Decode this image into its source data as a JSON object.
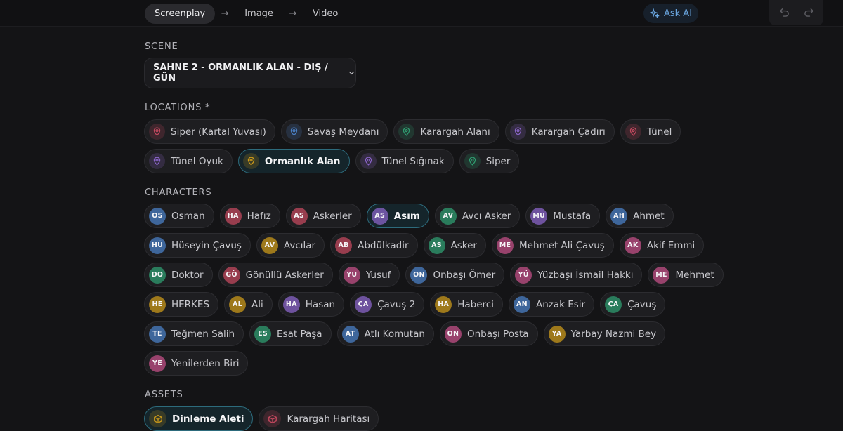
{
  "steps": [
    "Screenplay",
    "Image",
    "Video"
  ],
  "ask_ai": "Ask AI",
  "labels": {
    "scene": "SCENE",
    "locations": "LOCATIONS *",
    "characters": "CHARACTERS",
    "assets": "ASSETS"
  },
  "scene_value": "SAHNE 2 - ORMANLIK ALAN - DIŞ / GÜN",
  "colors": {
    "red": "#c2485e",
    "blue": "#4a7fc4",
    "green": "#2f9c70",
    "purple": "#8a64c8",
    "yellow": "#c9981a",
    "pink": "#c24f86",
    "selected_border": "#2d6b7c"
  },
  "locations": [
    {
      "label": "Siper (Kartal Yuvası)",
      "color": "red",
      "icon": "map-pin-icon"
    },
    {
      "label": "Savaş Meydanı",
      "color": "blue",
      "icon": "map-pin-icon"
    },
    {
      "label": "Karargah Alanı",
      "color": "green",
      "icon": "map-pin-icon"
    },
    {
      "label": "Karargah Çadırı",
      "color": "purple",
      "icon": "map-pin-icon"
    },
    {
      "label": "Tünel",
      "color": "red",
      "icon": "map-pin-icon"
    },
    {
      "label": "Tünel Oyuk",
      "color": "purple",
      "icon": "map-pin-icon"
    },
    {
      "label": "Ormanlık Alan",
      "color": "yellow",
      "icon": "map-pin-icon",
      "selected": true
    },
    {
      "label": "Tünel Sığınak",
      "color": "purple",
      "icon": "map-pin-icon"
    },
    {
      "label": "Siper",
      "color": "green",
      "icon": "map-pin-icon"
    }
  ],
  "characters": [
    {
      "initials": "OS",
      "name": "Osman",
      "color": "blue"
    },
    {
      "initials": "HA",
      "name": "Hafız",
      "color": "red"
    },
    {
      "initials": "AS",
      "name": "Askerler",
      "color": "red"
    },
    {
      "initials": "AS",
      "name": "Asım",
      "color": "purple",
      "selected": true
    },
    {
      "initials": "AV",
      "name": "Avcı Asker",
      "color": "green"
    },
    {
      "initials": "MU",
      "name": "Mustafa",
      "color": "purple"
    },
    {
      "initials": "AH",
      "name": "Ahmet",
      "color": "blue"
    },
    {
      "initials": "HÜ",
      "name": "Hüseyin Çavuş",
      "color": "blue"
    },
    {
      "initials": "AV",
      "name": "Avcılar",
      "color": "yellow"
    },
    {
      "initials": "AB",
      "name": "Abdülkadir",
      "color": "red"
    },
    {
      "initials": "AS",
      "name": "Asker",
      "color": "green"
    },
    {
      "initials": "ME",
      "name": "Mehmet Ali Çavuş",
      "color": "pink"
    },
    {
      "initials": "AK",
      "name": "Akif Emmi",
      "color": "pink"
    },
    {
      "initials": "DO",
      "name": "Doktor",
      "color": "green"
    },
    {
      "initials": "GÖ",
      "name": "Gönüllü Askerler",
      "color": "red"
    },
    {
      "initials": "YU",
      "name": "Yusuf",
      "color": "pink"
    },
    {
      "initials": "ON",
      "name": "Onbaşı Ömer",
      "color": "blue"
    },
    {
      "initials": "YÜ",
      "name": "Yüzbaşı İsmail Hakkı",
      "color": "pink"
    },
    {
      "initials": "ME",
      "name": "Mehmet",
      "color": "pink"
    },
    {
      "initials": "HE",
      "name": "HERKES",
      "color": "yellow"
    },
    {
      "initials": "AL",
      "name": "Ali",
      "color": "yellow"
    },
    {
      "initials": "HA",
      "name": "Hasan",
      "color": "purple"
    },
    {
      "initials": "ÇA",
      "name": "Çavuş 2",
      "color": "purple"
    },
    {
      "initials": "HA",
      "name": "Haberci",
      "color": "yellow"
    },
    {
      "initials": "AN",
      "name": "Anzak Esir",
      "color": "blue"
    },
    {
      "initials": "ÇA",
      "name": "Çavuş",
      "color": "green"
    },
    {
      "initials": "TE",
      "name": "Teğmen Salih",
      "color": "blue"
    },
    {
      "initials": "ES",
      "name": "Esat Paşa",
      "color": "green"
    },
    {
      "initials": "AT",
      "name": "Atlı Komutan",
      "color": "blue"
    },
    {
      "initials": "ON",
      "name": "Onbaşı Posta",
      "color": "pink"
    },
    {
      "initials": "YA",
      "name": "Yarbay Nazmi Bey",
      "color": "yellow"
    },
    {
      "initials": "YE",
      "name": "Yenilerden Biri",
      "color": "pink"
    }
  ],
  "assets": [
    {
      "label": "Dinleme Aleti",
      "color": "yellow",
      "icon": "cube-icon",
      "selected": true
    },
    {
      "label": "Karargah Haritası",
      "color": "red",
      "icon": "cube-icon"
    }
  ]
}
